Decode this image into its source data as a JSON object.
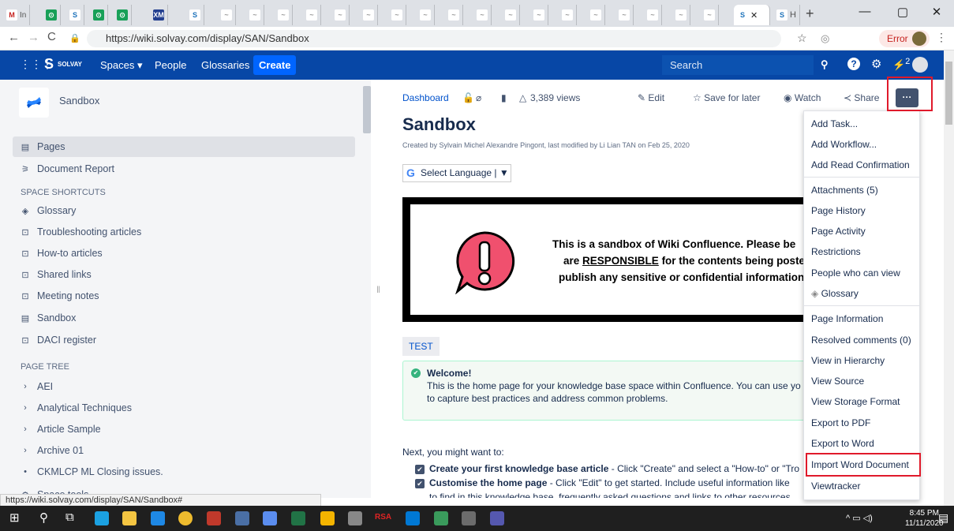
{
  "browser": {
    "url": "https://wiki.solvay.com/display/SAN/Sandbox",
    "status_url": "https://wiki.solvay.com/display/SAN/Sandbox#",
    "error_label": "Error",
    "active_tab_label": "S"
  },
  "header": {
    "brand": "SOLVAY",
    "spaces": "Spaces ▾",
    "people": "People",
    "glossaries": "Glossaries",
    "create": "Create",
    "search_placeholder": "Search",
    "notif_count": "2"
  },
  "sidebar": {
    "space_name": "Sandbox",
    "pages": "Pages",
    "document_report": "Document Report",
    "shortcuts_header": "SPACE SHORTCUTS",
    "shortcuts": [
      "Glossary",
      "Troubleshooting articles",
      "How-to articles",
      "Shared links",
      "Meeting notes",
      "Sandbox",
      "DACI register"
    ],
    "tree_header": "PAGE TREE",
    "tree": [
      "AEI",
      "Analytical Techniques",
      "Article Sample",
      "Archive 01",
      "CKMLCP ML Closing issues."
    ],
    "space_tools": "Space tools"
  },
  "page": {
    "breadcrumb": "Dashboard",
    "views": "3,389 views",
    "edit": "Edit",
    "save_for_later": "Save for later",
    "watch": "Watch",
    "share": "Share",
    "more": "···",
    "title": "Sandbox",
    "byline": "Created by Sylvain Michel Alexandre Pingont, last modified by Li Lian TAN on Feb 25, 2020",
    "language": "Select Language",
    "banner_line1": "This is a sandbox of Wiki Confluence. Please be",
    "banner_line2_pre": "are ",
    "banner_line2_u": "RESPONSIBLE",
    "banner_line2_post": " for the contents being posted",
    "banner_line3": "publish any sensitive or confidential information",
    "tag": "TEST",
    "welcome_title": "Welcome!",
    "welcome_body1": "This is the home page for your knowledge base space within Confluence. You can use yo",
    "welcome_body2": "to capture best practices and address common problems.",
    "next": "Next, you might want to:",
    "task1_bold": "Create your first knowledge base article",
    "task1_rest": " - Click \"Create\" and select a \"How-to\" or \"Tro",
    "task2_bold": "Customise the home page",
    "task2_rest": " - Click \"Edit\" to get started. Include useful information like",
    "task2_line2": "to find in this knowledge base, frequently asked questions and links to other resources."
  },
  "menu": {
    "items": [
      "Add Task...",
      "Add Workflow...",
      "Add Read Confirmation",
      "Attachments (5)",
      "Page History",
      "Page Activity",
      "Restrictions",
      "People who can view",
      "Glossary",
      "Page Information",
      "Resolved comments (0)",
      "View in Hierarchy",
      "View Source",
      "View Storage Format",
      "Export to PDF",
      "Export to Word",
      "Import Word Document",
      "Viewtracker"
    ]
  },
  "clock": {
    "time": "8:45 PM",
    "date": "11/11/2020"
  }
}
